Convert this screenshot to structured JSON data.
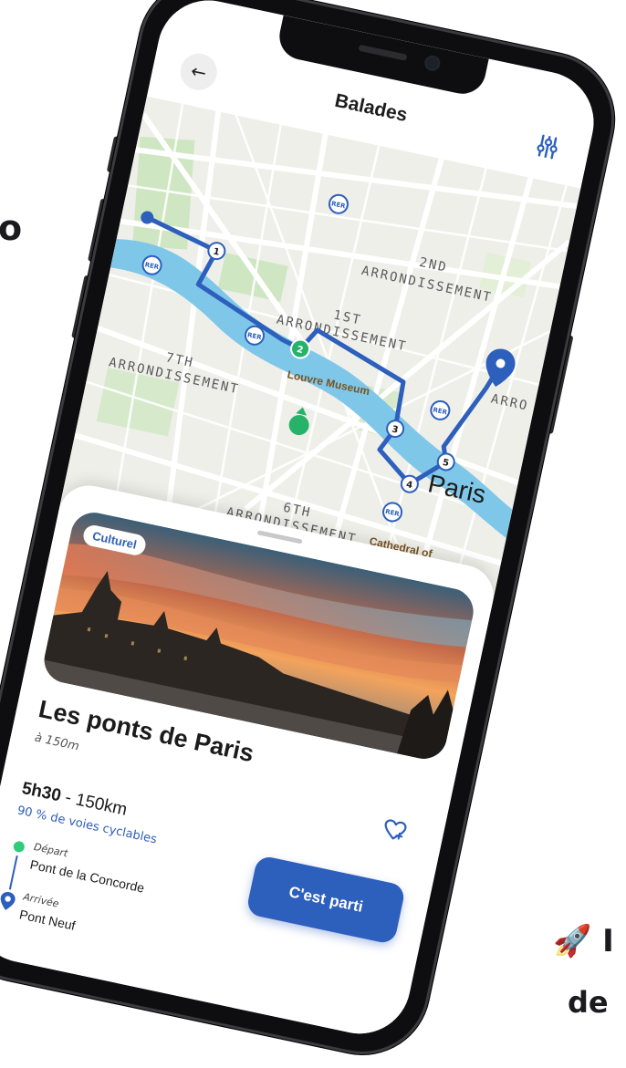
{
  "edge_fragments": {
    "left": "o",
    "bottom_right_line1": "🚀 I",
    "bottom_right_line2": "de"
  },
  "app": {
    "title": "Balades",
    "back_icon": "arrow-left-icon",
    "filter_icon": "sliders-icon"
  },
  "map": {
    "labels": {
      "arr2": "2ND\nARRONDISSEMENT",
      "arr1": "1ST\nARRONDISSEMENT",
      "arr7": "7TH\nARRONDISSEMENT",
      "arr6": "6TH\nARRONDISSEMENT",
      "arro": "ARRO",
      "louvre": "Louvre Museum",
      "paris": "Paris",
      "cathedral": "Cathedral of\nNotre Dame",
      "rer": "RER"
    },
    "stops": [
      "1",
      "2",
      "3",
      "4",
      "5"
    ],
    "route_color": "#2d5fbd",
    "active_stop_color": "#27b26a"
  },
  "card": {
    "category": "Culturel",
    "title": "Les ponts de Paris",
    "distance_away": "à 150m",
    "duration": "5h30",
    "length": " - 150km",
    "bike_ratio": "90 % de voies cyclables",
    "start_label": "Départ",
    "start_place": "Pont de la Concorde",
    "end_label": "Arrivée",
    "end_place": "Pont Neuf",
    "cta": "C'est parti",
    "favorite_icon": "heart-plus-icon"
  }
}
